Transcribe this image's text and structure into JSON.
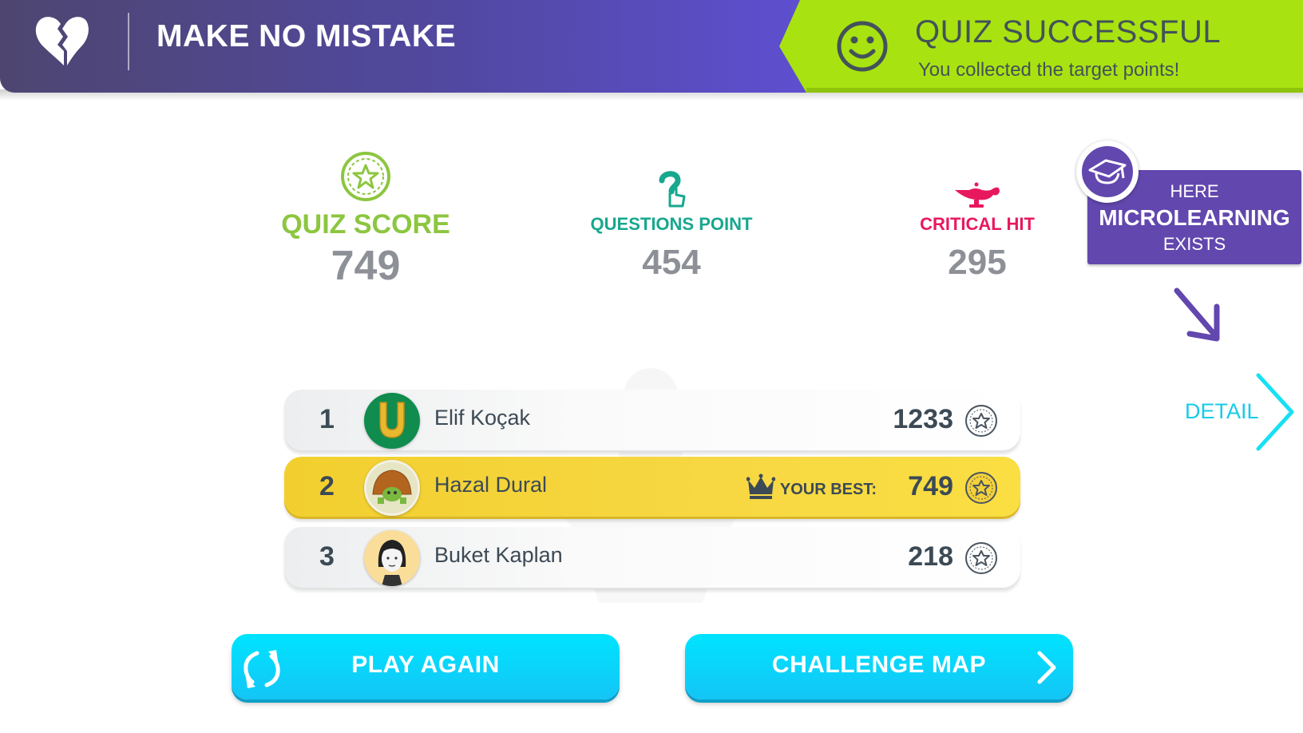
{
  "header": {
    "mode_icon": "broken-heart-icon",
    "mode_title": "MAKE NO MISTAKE",
    "result_icon": "smiley-icon",
    "result_title": "QUIZ SUCCESSFUL",
    "result_subtitle": "You collected the target points!"
  },
  "stats": [
    {
      "label": "QUIZ SCORE",
      "value": "749",
      "icon": "star-coin-icon",
      "color": "#8cc63f"
    },
    {
      "label": "QUESTIONS POINT",
      "value": "454",
      "icon": "question-hand-icon",
      "color": "#17a88e"
    },
    {
      "label": "CRITICAL HIT",
      "value": "295",
      "icon": "magic-lamp-icon",
      "color": "#e8185e"
    }
  ],
  "microlearning": {
    "icon": "graduation-cap-icon",
    "line1": "HERE",
    "line2": "MICROLEARNING",
    "line3": "EXISTS",
    "detail_label": "DETAIL"
  },
  "leaderboard": {
    "rows": [
      {
        "rank": "1",
        "name": "Elif Koçak",
        "score": "1233",
        "avatar": "horseshoe-avatar",
        "is_current_user": false
      },
      {
        "rank": "2",
        "name": "Hazal Dural",
        "score": "749",
        "avatar": "turtle-avatar",
        "is_current_user": true,
        "best_label": "YOUR BEST:"
      },
      {
        "rank": "3",
        "name": "Buket Kaplan",
        "score": "218",
        "avatar": "woman-avatar",
        "is_current_user": false
      }
    ]
  },
  "buttons": {
    "play_again": "PLAY AGAIN",
    "challenge_map": "CHALLENGE MAP"
  },
  "colors": {
    "header_purple": "#5148a0",
    "success_green": "#a8e311",
    "highlight_yellow": "#f7d843",
    "button_cyan": "#00d8fb",
    "micro_purple": "#6247ae"
  }
}
